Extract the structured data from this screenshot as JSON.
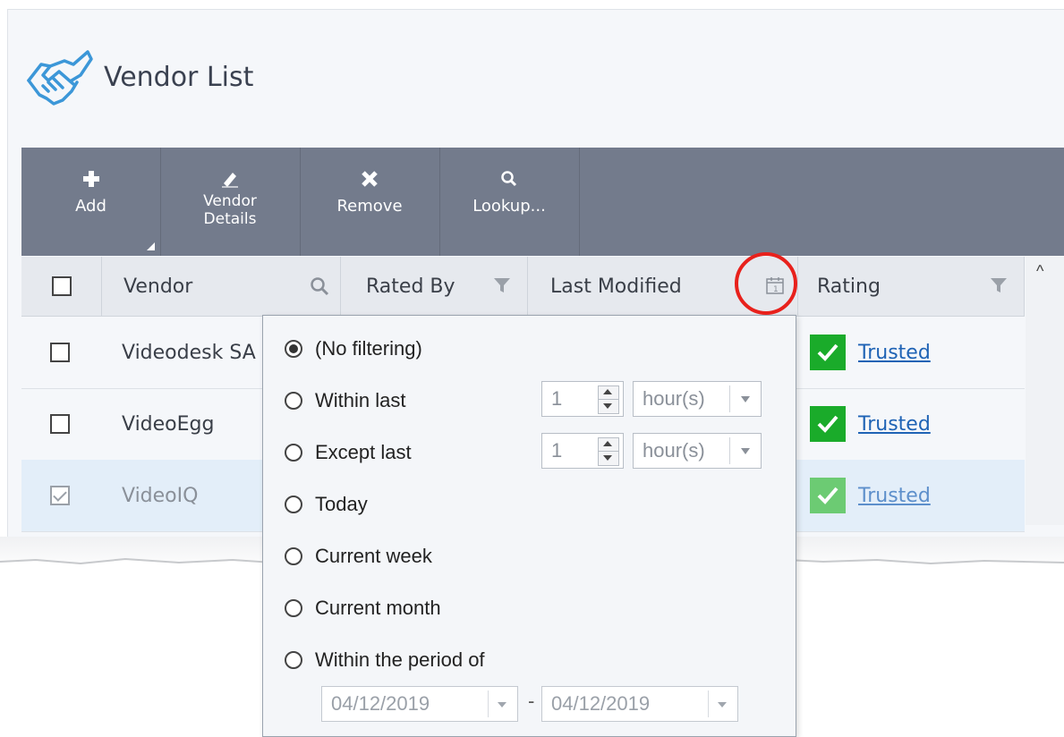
{
  "page": {
    "title": "Vendor List",
    "logo_icon": "handshake-icon"
  },
  "toolbar": {
    "buttons": [
      {
        "label": "Add",
        "icon": "plus-icon"
      },
      {
        "label": "Vendor\nDetails",
        "icon": "pencil-icon"
      },
      {
        "label": "Remove",
        "icon": "x-icon"
      },
      {
        "label": "Lookup...",
        "icon": "search-icon"
      }
    ]
  },
  "table": {
    "columns": [
      {
        "label": "Vendor",
        "icon": "search-icon"
      },
      {
        "label": "Rated By",
        "icon": "filter-icon"
      },
      {
        "label": "Last Modified",
        "icon": "calendar-icon"
      },
      {
        "label": "Rating",
        "icon": "filter-icon"
      }
    ],
    "rows": [
      {
        "vendor": "Videodesk SA",
        "rating": "Trusted",
        "checked": false
      },
      {
        "vendor": "VideoEgg",
        "rating": "Trusted",
        "checked": false
      },
      {
        "vendor": "VideoIQ",
        "rating": "Trusted",
        "checked": true
      }
    ]
  },
  "filter_popup": {
    "options": [
      {
        "label": "(No filtering)",
        "selected": true
      },
      {
        "label": "Within last",
        "selected": false
      },
      {
        "label": "Except last",
        "selected": false
      },
      {
        "label": "Today",
        "selected": false
      },
      {
        "label": "Current week",
        "selected": false
      },
      {
        "label": "Current month",
        "selected": false
      },
      {
        "label": "Within the period of",
        "selected": false
      }
    ],
    "within_last": {
      "value": "1",
      "unit": "hour(s)"
    },
    "except_last": {
      "value": "1",
      "unit": "hour(s)"
    },
    "period": {
      "from": "04/12/2019",
      "separator": "-",
      "to": "04/12/2019"
    }
  },
  "colors": {
    "toolbar": "#737b8c",
    "accent_ok": "#1aab2a",
    "highlight": "#e8211c",
    "link": "#1f63b5"
  }
}
